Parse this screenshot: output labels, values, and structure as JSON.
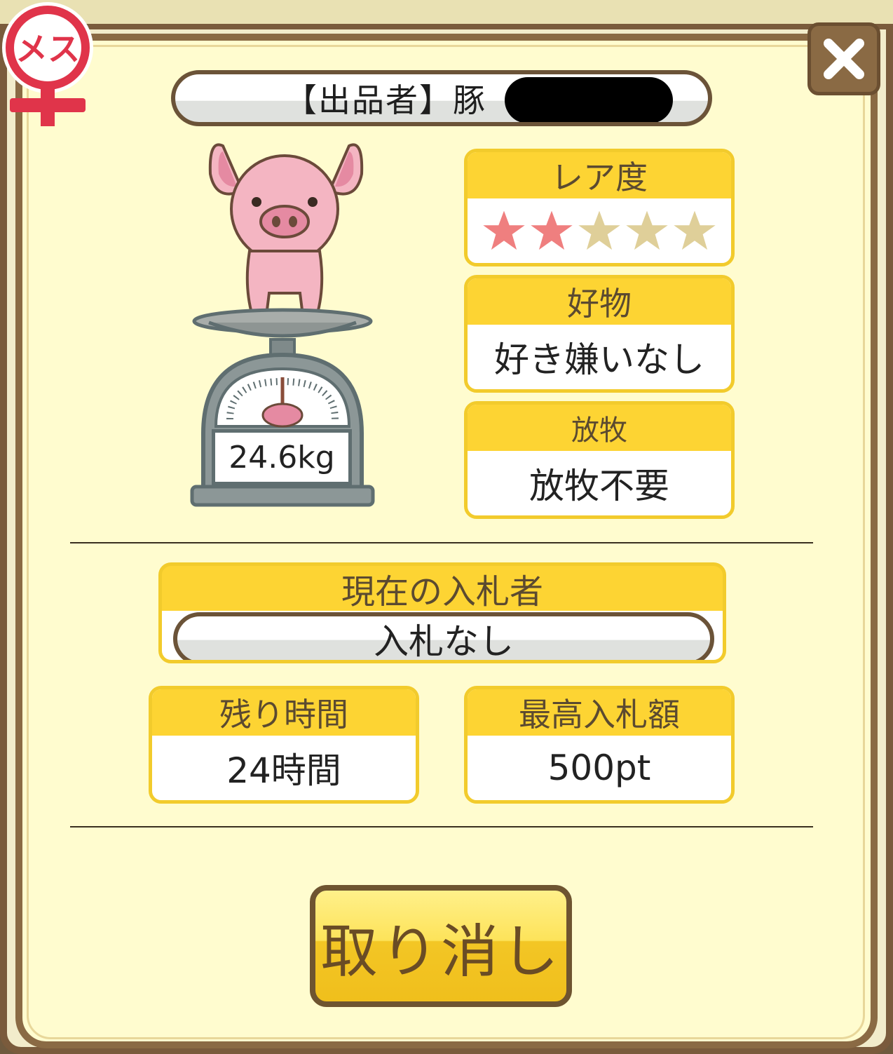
{
  "seller": {
    "label": "【出品者】豚"
  },
  "gender": {
    "badge_text": "メス",
    "icon": "female-symbol-icon"
  },
  "close": {
    "icon": "close-icon",
    "label": "✕"
  },
  "pig": {
    "weight": "24.6kg",
    "icon": "pig-on-scale-illustration"
  },
  "rarity": {
    "label": "レア度",
    "stars_total": 5,
    "stars_filled": 2,
    "filled_color": "#ef7f7f",
    "empty_color": "#dfcf99"
  },
  "favorite_food": {
    "label": "好物",
    "value": "好き嫌いなし"
  },
  "grazing": {
    "label": "放牧",
    "value": "放牧不要"
  },
  "bidder": {
    "label": "現在の入札者",
    "value": "入札なし"
  },
  "time_left": {
    "label": "残り時間",
    "value": "24時間"
  },
  "max_bid": {
    "label": "最高入札額",
    "value": "500pt"
  },
  "cancel": {
    "label": "取り消し"
  },
  "colors": {
    "panel_bg": "#fffccf",
    "header_yellow": "#fdd433",
    "frame_brown": "#8a6a44"
  }
}
